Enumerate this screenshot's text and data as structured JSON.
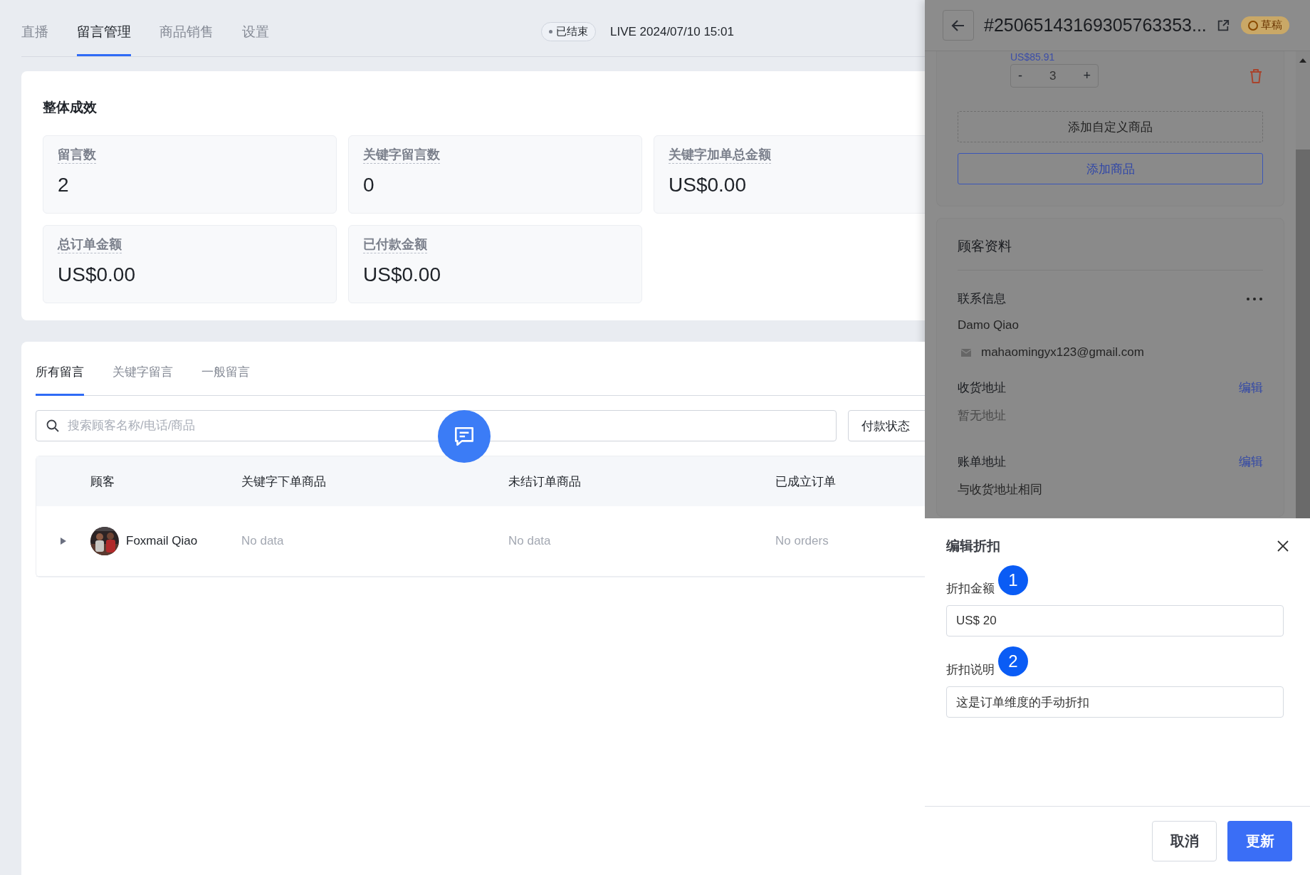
{
  "nav": {
    "tabs": [
      {
        "label": "直播",
        "selected": false
      },
      {
        "label": "留言管理",
        "selected": true
      },
      {
        "label": "商品销售",
        "selected": false
      },
      {
        "label": "设置",
        "selected": false
      }
    ],
    "status": "已结束",
    "live_time": "LIVE 2024/07/10 15:01"
  },
  "overview": {
    "title": "整体成效",
    "stats": [
      {
        "label": "留言数",
        "value": "2"
      },
      {
        "label": "关键字留言数",
        "value": "0"
      },
      {
        "label": "关键字加单总金额",
        "value": "US$0.00"
      },
      {
        "label": "总订单金额",
        "value": "US$0.00"
      },
      {
        "label": "已付款金额",
        "value": "US$0.00"
      }
    ]
  },
  "comments": {
    "tabs": [
      {
        "label": "所有留言",
        "selected": true
      },
      {
        "label": "关键字留言",
        "selected": false
      },
      {
        "label": "一般留言",
        "selected": false
      }
    ],
    "search": {
      "placeholder": "搜索顾客名称/电话/商品"
    },
    "filter": "付款状态",
    "table": {
      "columns": [
        "顾客",
        "关键字下单商品",
        "未结订单商品",
        "已成立订单"
      ],
      "rows": [
        {
          "expanded": false,
          "customer": "Foxmail Qiao",
          "keyword_items": "No data",
          "open_items": "No data",
          "orders": "No orders"
        }
      ]
    }
  },
  "drawer": {
    "title": "#25065143169305763353...",
    "status": "草稿",
    "product": {
      "price": "US$85.91",
      "decrement": "-",
      "quantity": "3",
      "increment": "+"
    },
    "add_custom": "添加自定义商品",
    "add_product": "添加商品",
    "customer": {
      "title": "顾客资料",
      "contact_label": "联系信息",
      "name": "Damo Qiao",
      "email": "mahaomingyx123@gmail.com",
      "shipping_label": "收货地址",
      "shipping_edit": "编辑",
      "shipping_value": "暂无地址",
      "billing_label": "账单地址",
      "billing_edit": "编辑",
      "billing_value": "与收货地址相同"
    }
  },
  "dialog": {
    "title": "编辑折扣",
    "fields": [
      {
        "label": "折扣金额",
        "marker": "1",
        "value": "US$ 20"
      },
      {
        "label": "折扣说明",
        "marker": "2",
        "value": "这是订单维度的手动折扣"
      }
    ],
    "cancel": "取消",
    "submit": "更新"
  }
}
